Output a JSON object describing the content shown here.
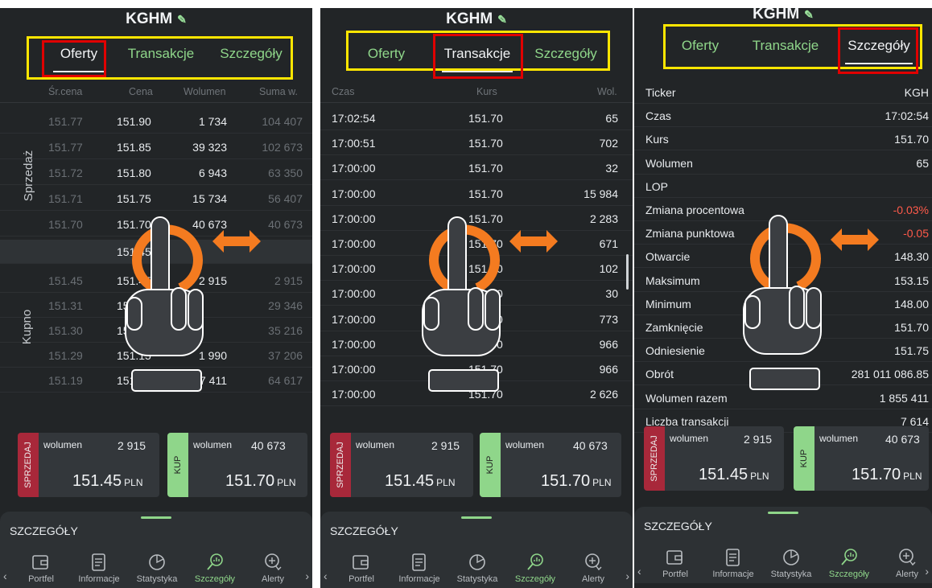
{
  "ticker": "KGHM",
  "tabs": [
    "Oferty",
    "Transakcje",
    "Szczegóły"
  ],
  "orderbook": {
    "columns": [
      "Śr.cena",
      "Cena",
      "Wolumen",
      "Suma w."
    ],
    "sell_label": "Sprzedaż",
    "buy_label": "Kupno",
    "sell_rows": [
      {
        "avg": "151.77",
        "price": "151.90",
        "vol": "1 734",
        "sum": "104 407"
      },
      {
        "avg": "151.77",
        "price": "151.85",
        "vol": "39 323",
        "sum": "102 673"
      },
      {
        "avg": "151.72",
        "price": "151.80",
        "vol": "6 943",
        "sum": "63 350"
      },
      {
        "avg": "151.71",
        "price": "151.75",
        "vol": "15 734",
        "sum": "56 407"
      },
      {
        "avg": "151.70",
        "price": "151.70",
        "vol": "40 673",
        "sum": "40 673"
      }
    ],
    "mid_price": "151.45",
    "buy_rows": [
      {
        "avg": "151.45",
        "price": "151.45",
        "vol": "2 915",
        "sum": "2 915"
      },
      {
        "avg": "151.31",
        "price": "151.30",
        "vol": "",
        "sum": "29 346"
      },
      {
        "avg": "151.30",
        "price": "151.",
        "vol": "",
        "sum": "35 216"
      },
      {
        "avg": "151.29",
        "price": "151.15",
        "vol": "1 990",
        "sum": "37 206"
      },
      {
        "avg": "151.19",
        "price": "151.05",
        "vol": "27 411",
        "sum": "64 617"
      }
    ]
  },
  "trades": {
    "columns": [
      "Czas",
      "Kurs",
      "Wol."
    ],
    "rows": [
      {
        "time": "17:02:54",
        "price": "151.70",
        "vol": "65"
      },
      {
        "time": "17:00:51",
        "price": "151.70",
        "vol": "702"
      },
      {
        "time": "17:00:00",
        "price": "151.70",
        "vol": "32"
      },
      {
        "time": "17:00:00",
        "price": "151.70",
        "vol": "15 984"
      },
      {
        "time": "17:00:00",
        "price": "151.70",
        "vol": "2 283"
      },
      {
        "time": "17:00:00",
        "price": "151.70",
        "vol": "671"
      },
      {
        "time": "17:00:00",
        "price": "151.70",
        "vol": "102"
      },
      {
        "time": "17:00:00",
        "price": "151.70",
        "vol": "30"
      },
      {
        "time": "17:00:00",
        "price": "151.70",
        "vol": "773"
      },
      {
        "time": "17:00:00",
        "price": "151.70",
        "vol": "966"
      },
      {
        "time": "17:00:00",
        "price": "151.70",
        "vol": "966"
      },
      {
        "time": "17:00:00",
        "price": "151.70",
        "vol": "2 626"
      }
    ]
  },
  "details": [
    {
      "label": "Ticker",
      "value": "KGH"
    },
    {
      "label": "Czas",
      "value": "17:02:54"
    },
    {
      "label": "Kurs",
      "value": "151.70"
    },
    {
      "label": "Wolumen",
      "value": "65"
    },
    {
      "label": "LOP",
      "value": ""
    },
    {
      "label": "Zmiana procentowa",
      "value": "-0.03%"
    },
    {
      "label": "Zmiana punktowa",
      "value": "-0.05"
    },
    {
      "label": "Otwarcie",
      "value": "148.30"
    },
    {
      "label": "Maksimum",
      "value": "153.15"
    },
    {
      "label": "Minimum",
      "value": "148.00"
    },
    {
      "label": "Zamknięcie",
      "value": "151.70"
    },
    {
      "label": "Odniesienie",
      "value": "151.75"
    },
    {
      "label": "Obrót",
      "value": "281 011 086.85"
    },
    {
      "label": "Wolumen razem",
      "value": "1 855 411"
    },
    {
      "label": "Liczba transakcji",
      "value": "7 614"
    }
  ],
  "sell_card": {
    "side": "SPRZEDAJ",
    "vol_label": "wolumen",
    "vol": "2 915",
    "price": "151.45",
    "currency": "PLN"
  },
  "buy_card": {
    "side": "KUP",
    "vol_label": "wolumen",
    "vol": "40 673",
    "price": "151.70",
    "currency": "PLN"
  },
  "sheet_title": "SZCZEGÓŁY",
  "nav": [
    "Portfel",
    "Informacje",
    "Statystyka",
    "Szczegóły",
    "Alerty"
  ],
  "colors": {
    "accent_green": "#8fd68a",
    "sell_red": "#a8283a",
    "buy_green": "#8fd68a",
    "highlight_yellow": "#ffe600",
    "highlight_red": "#e00000",
    "gesture_orange": "#f47b20"
  },
  "icons": [
    "pencil-icon",
    "tap-hand-icon",
    "swipe-arrow-icon",
    "wallet-icon",
    "document-icon",
    "chart-icon",
    "magnifier-chart-icon",
    "alert-plus-icon",
    "chevron-left-icon",
    "chevron-right-icon"
  ]
}
